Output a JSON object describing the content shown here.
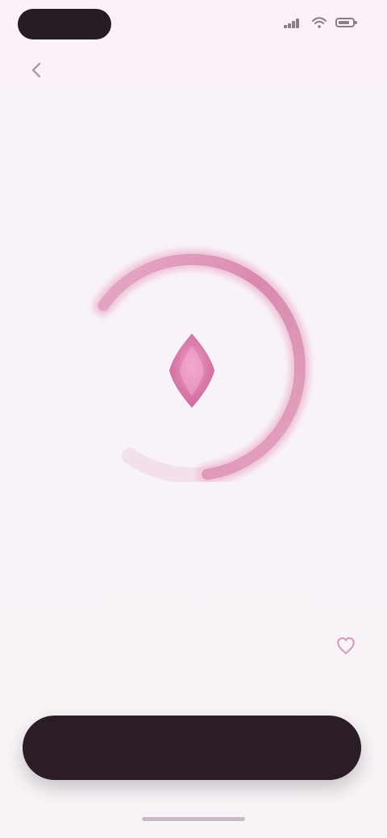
{
  "status_bar": {
    "time": "",
    "battery_level": 0.8,
    "icons": {
      "signal": "signal-icon",
      "wifi": "wifi-icon",
      "battery": "battery-icon"
    }
  },
  "top_nav": {
    "back_icon": "chevron-left-icon",
    "title": ""
  },
  "headline": {
    "muted": "",
    "bold": ""
  },
  "gauge": {
    "progress": 0.84,
    "center_icon": "diamond-icon",
    "colors": {
      "track": "#f0d7e5",
      "arc": "#db98b8",
      "arc_glow": "#efbfd4",
      "icon": "#d774a5"
    }
  },
  "result": {
    "value": "",
    "subtitle": ""
  },
  "bottom": {
    "left_caption": "",
    "right_caption": "",
    "right_icon": "heart-icon"
  },
  "primary_button": {
    "label": ""
  },
  "colors": {
    "background": "#f7f3f7",
    "accent": "#d774a5",
    "dark": "#2a1d25"
  }
}
